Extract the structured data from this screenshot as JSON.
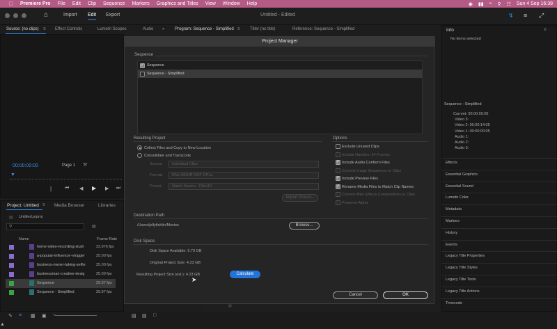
{
  "menubar": {
    "items": [
      "Premiere Pro",
      "File",
      "Edit",
      "Clip",
      "Sequence",
      "Markers",
      "Graphics and Titles",
      "View",
      "Window",
      "Help"
    ],
    "datetime": "Sun 4 Sep  16:38"
  },
  "header": {
    "home_icon": "home-icon",
    "tabs": [
      "Import",
      "Edit",
      "Export"
    ],
    "active_tab": "Edit",
    "doc_title": "Untitled - Edited"
  },
  "panel_tabs": {
    "source": [
      "Source: (no clips)",
      "Effect Controls",
      "Lumetri Scopes",
      "Audio"
    ],
    "program": [
      "Program: Sequence - Simplified",
      "Titler (no title)",
      "Reference: Sequence - Simplified"
    ],
    "info": "Info"
  },
  "source_monitor": {
    "timecode": "00:00:00:00",
    "page": "Page 1"
  },
  "info_panel": {
    "no_items": "No items selected",
    "sequence_name": "Sequence - Simplified",
    "lines": [
      "Current: 00:00:00:05",
      "Video 3:",
      "Video 2: 00:00:14:05",
      "Video 1: 00:00:00:05",
      "Audio 1:",
      "Audio 2:",
      "Audio 3:"
    ]
  },
  "right_panels": [
    "Effects",
    "Essential Graphics",
    "Essential Sound",
    "Lumetri Color",
    "Metadata",
    "Markers",
    "History",
    "Events",
    "Legacy Title Properties",
    "Legacy Title Styles",
    "Legacy Title Tools",
    "Legacy Title Actions",
    "Timecode"
  ],
  "project_panel": {
    "tabs": [
      "Project: Untitled",
      "Media Browser",
      "Libraries"
    ],
    "file": "Untitled.prproj",
    "col_name": "Name",
    "col_frame": "Frame Rate",
    "rows": [
      {
        "name": "home-video-recording-studi",
        "rate": "23.976 fps",
        "color": "#8b6bd0"
      },
      {
        "name": "a-popular-influencer-vlogger",
        "rate": "25.00 fps",
        "color": "#8b6bd0"
      },
      {
        "name": "business-owner-taking-selfie",
        "rate": "25.00 fps",
        "color": "#8b6bd0"
      },
      {
        "name": "businessman-creative-desig",
        "rate": "25.00 fps",
        "color": "#8b6bd0"
      },
      {
        "name": "Sequence",
        "rate": "29.97 fps",
        "color": "#36a447"
      },
      {
        "name": "Sequence - Simplified",
        "rate": "29.97 fps",
        "color": "#36a447"
      }
    ]
  },
  "modal": {
    "title": "Project Manager",
    "sequence_label": "Sequence",
    "sequences": [
      {
        "name": "Sequence",
        "checked": true
      },
      {
        "name": "Sequence - Simplified",
        "checked": false
      }
    ],
    "resulting_project": {
      "label": "Resulting Project",
      "opt1": "Collect Files and Copy to New Location",
      "opt2": "Consolidate and Transcode",
      "source_label": "Source:",
      "source_value": "Individual Clips",
      "format_label": "Format:",
      "format_value": "DNx HD/HR MXF OP1a",
      "preset_label": "Preset:",
      "preset_value": "Match Source - DNxHD",
      "import_preset": "Import Preset..."
    },
    "options": {
      "label": "Options",
      "items": [
        {
          "text": "Exclude Unused Clips",
          "checked": false,
          "enabled": true
        },
        {
          "text": "Include Handles:  24 Frames",
          "checked": false,
          "enabled": false
        },
        {
          "text": "Include Audio Conform Files",
          "checked": true,
          "enabled": true
        },
        {
          "text": "Convert Image Sequences to Clips",
          "checked": false,
          "enabled": false
        },
        {
          "text": "Include Preview Files",
          "checked": true,
          "enabled": true
        },
        {
          "text": "Rename Media Files to Match Clip Names",
          "checked": true,
          "enabled": true
        },
        {
          "text": "Convert After Effects Compositions to Clips",
          "checked": false,
          "enabled": false
        },
        {
          "text": "Preserve Alpha",
          "checked": false,
          "enabled": false
        }
      ]
    },
    "destination": {
      "label": "Destination Path",
      "path": "/Users/jellyfishlin/Movies",
      "browse": "Browse..."
    },
    "disk": {
      "label": "Disk Space",
      "available": "Disk Space Available:  9.79 GB",
      "original": "Original Project Size:  4.23 GB",
      "resulting": "Resulting Project Size (est.):  4.23 GB",
      "calculate": "Calculate"
    },
    "cancel": "Cancel",
    "ok": "OK"
  }
}
